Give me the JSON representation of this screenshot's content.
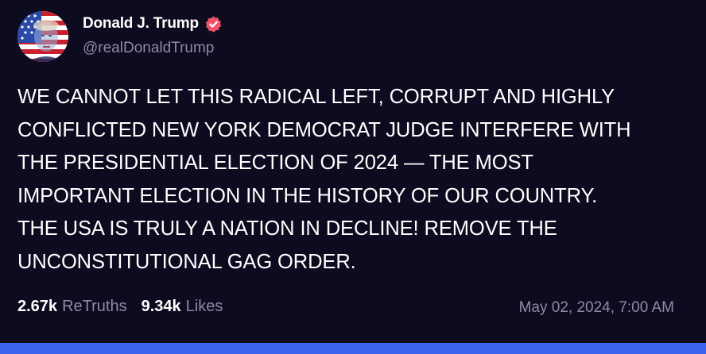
{
  "post": {
    "display_name": "Donald J. Trump",
    "handle": "@realDonaldTrump",
    "verified_icon": "verified-badge-icon",
    "verified_color": "#f25268",
    "text": "WE CANNOT LET THIS RADICAL LEFT, CORRUPT AND HIGHLY\nCONFLICTED NEW YORK DEMOCRAT JUDGE INTERFERE WITH\nTHE PRESIDENTIAL ELECTION OF 2024 — THE MOST\nIMPORTANT ELECTION IN THE HISTORY OF OUR COUNTRY.\nTHE USA IS TRULY A NATION IN DECLINE! REMOVE THE\nUNCONSTITUTIONAL GAG ORDER.",
    "retruths_count": "2.67k",
    "retruths_label": "ReTruths",
    "likes_count": "9.34k",
    "likes_label": "Likes",
    "timestamp": "May 02, 2024, 7:00 AM"
  },
  "colors": {
    "background": "#0c0b1f",
    "muted_text": "#8e8ba3",
    "accent_bar": "#3a63f0"
  }
}
